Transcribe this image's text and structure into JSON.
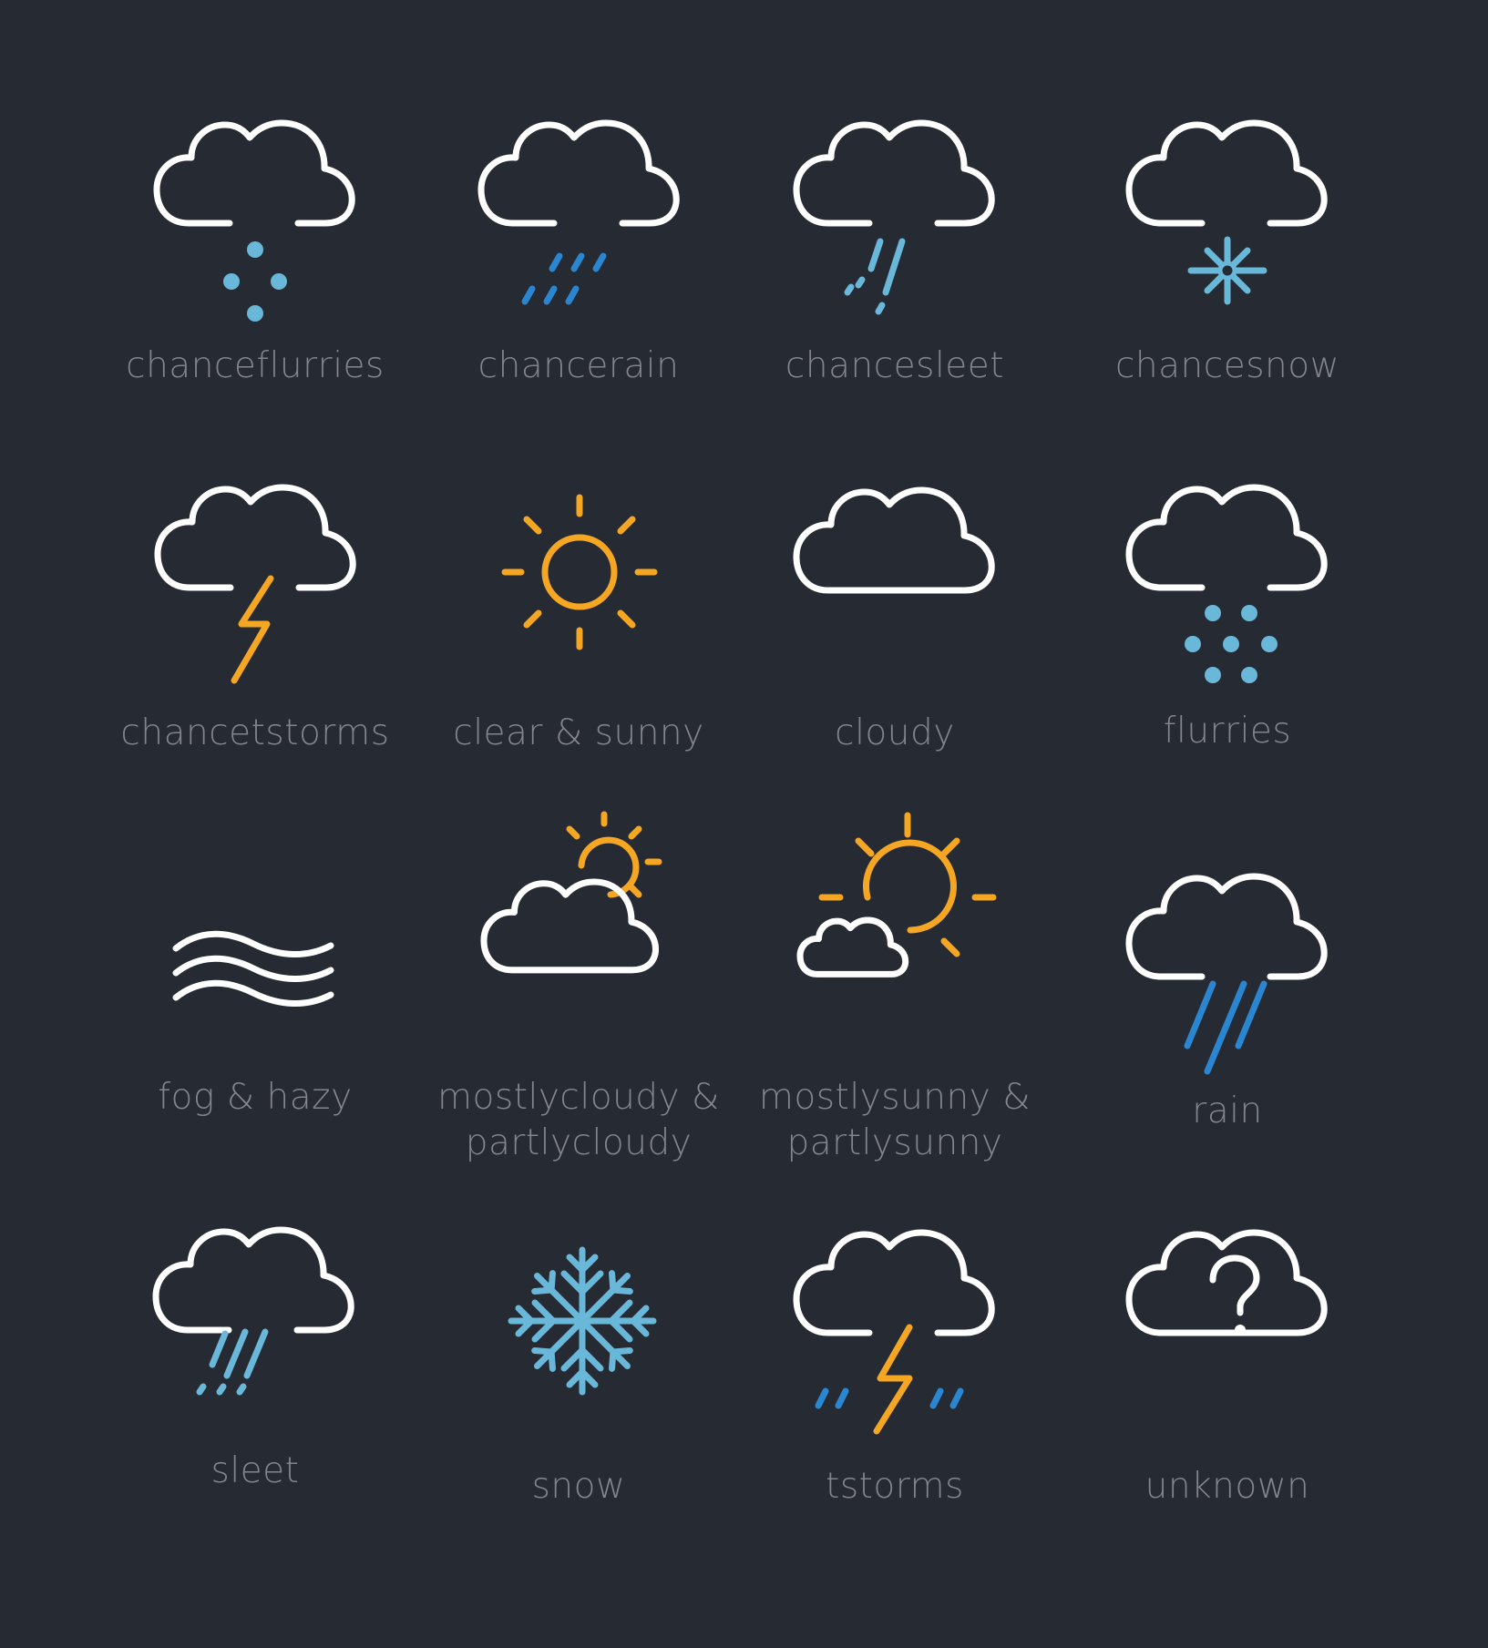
{
  "background_color": "#262a33",
  "colors": {
    "outline": "#ffffff",
    "light_blue": "#6ab8d9",
    "dark_blue": "#2a86d1",
    "orange": "#f5a623",
    "label": "#82858c"
  },
  "icons": [
    {
      "icon": "chanceflurries-icon",
      "label": "chanceflurries"
    },
    {
      "icon": "chancerain-icon",
      "label": "chancerain"
    },
    {
      "icon": "chancesleet-icon",
      "label": "chancesleet"
    },
    {
      "icon": "chancesnow-icon",
      "label": "chancesnow"
    },
    {
      "icon": "chancetstorms-icon",
      "label": "chancetstorms"
    },
    {
      "icon": "sun-icon",
      "label": "clear & sunny"
    },
    {
      "icon": "cloud-icon",
      "label": "cloudy"
    },
    {
      "icon": "flurries-icon",
      "label": "flurries"
    },
    {
      "icon": "fog-icon",
      "label": "fog & hazy"
    },
    {
      "icon": "cloud-sun-icon",
      "label_line1": "mostlycloudy &",
      "label_line2": "partlycloudy"
    },
    {
      "icon": "sun-cloud-icon",
      "label_line1": "mostlysunny &",
      "label_line2": "partlysunny"
    },
    {
      "icon": "rain-icon",
      "label": "rain"
    },
    {
      "icon": "sleet-icon",
      "label": "sleet"
    },
    {
      "icon": "snowflake-icon",
      "label": "snow"
    },
    {
      "icon": "tstorms-icon",
      "label": "tstorms"
    },
    {
      "icon": "unknown-cloud-icon",
      "label": "unknown"
    }
  ]
}
